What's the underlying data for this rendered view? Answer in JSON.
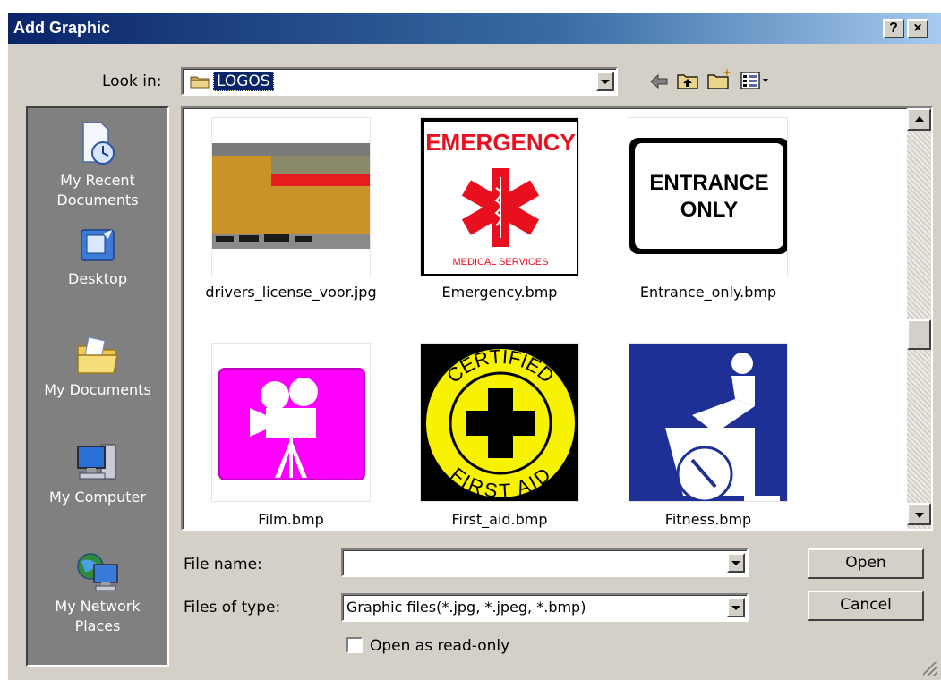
{
  "window": {
    "title": "Add Graphic",
    "help_label": "?",
    "close_label": "×"
  },
  "look_in": {
    "label": "Look in:",
    "value": "LOGOS"
  },
  "places": [
    {
      "label_line1": "My Recent",
      "label_line2": "Documents",
      "icon": "recent-documents-icon"
    },
    {
      "label_line1": "Desktop",
      "label_line2": "",
      "icon": "desktop-icon"
    },
    {
      "label_line1": "My Documents",
      "label_line2": "",
      "icon": "my-documents-icon"
    },
    {
      "label_line1": "My Computer",
      "label_line2": "",
      "icon": "my-computer-icon"
    },
    {
      "label_line1": "My Network",
      "label_line2": "Places",
      "icon": "my-network-places-icon"
    }
  ],
  "files": [
    {
      "name": "drivers_license_voor.jpg"
    },
    {
      "name": "Emergency.bmp",
      "thumb_title": "EMERGENCY",
      "thumb_caption": "MEDICAL SERVICES"
    },
    {
      "name": "Entrance_only.bmp",
      "thumb_line1": "ENTRANCE",
      "thumb_line2": "ONLY"
    },
    {
      "name": "Film.bmp"
    },
    {
      "name": "First_aid.bmp",
      "thumb_top": "CERTIFIED",
      "thumb_bottom": "FIRST AID"
    },
    {
      "name": "Fitness.bmp"
    }
  ],
  "file_name": {
    "label": "File name:",
    "value": ""
  },
  "file_type": {
    "label": "Files of type:",
    "value": "Graphic files(*.jpg, *.jpeg, *.bmp)"
  },
  "read_only": {
    "label": "Open as read-only",
    "checked": false
  },
  "buttons": {
    "open": "Open",
    "cancel": "Cancel"
  },
  "colors": {
    "title_start": "#0a246a",
    "title_end": "#a6caf0",
    "face": "#d4d0c8",
    "selection": "#0a246a",
    "emergency_red": "#e8101e",
    "film_magenta": "#ff00ff",
    "fitness_blue": "#1e2f96",
    "first_aid_yellow": "#f6f200"
  }
}
